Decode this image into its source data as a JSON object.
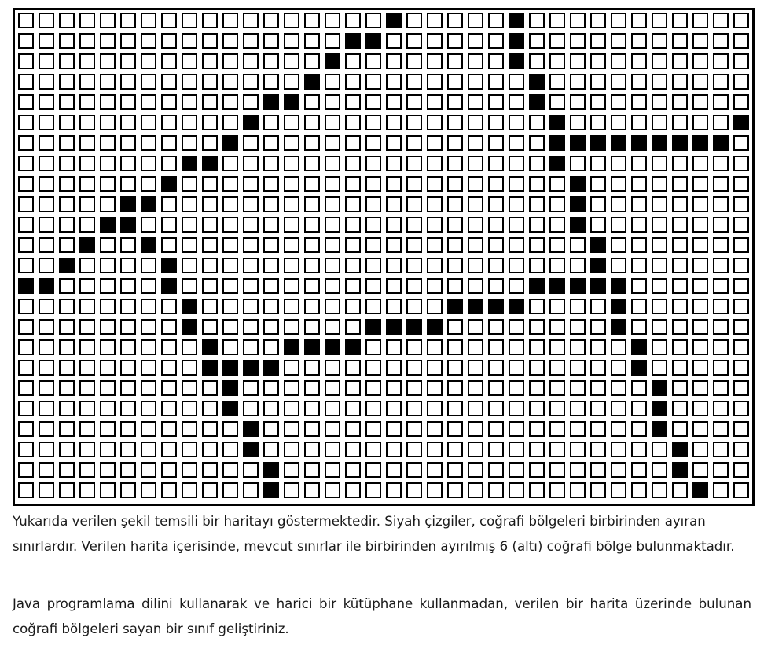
{
  "map": {
    "columns": 36,
    "rows": 24,
    "colors": {
      "border": "#000000",
      "empty_cell": "#ffffff",
      "filled_cell": "#000000"
    },
    "filled_cells": [
      [
        0,
        18
      ],
      [
        0,
        24
      ],
      [
        1,
        16
      ],
      [
        1,
        17
      ],
      [
        1,
        24
      ],
      [
        2,
        15
      ],
      [
        2,
        24
      ],
      [
        3,
        14
      ],
      [
        3,
        25
      ],
      [
        4,
        12
      ],
      [
        4,
        13
      ],
      [
        4,
        25
      ],
      [
        5,
        11
      ],
      [
        5,
        26
      ],
      [
        5,
        35
      ],
      [
        6,
        10
      ],
      [
        6,
        26
      ],
      [
        6,
        27
      ],
      [
        6,
        28
      ],
      [
        6,
        29
      ],
      [
        6,
        30
      ],
      [
        6,
        31
      ],
      [
        6,
        32
      ],
      [
        6,
        33
      ],
      [
        6,
        34
      ],
      [
        7,
        8
      ],
      [
        7,
        9
      ],
      [
        7,
        26
      ],
      [
        8,
        7
      ],
      [
        8,
        27
      ],
      [
        9,
        5
      ],
      [
        9,
        6
      ],
      [
        9,
        27
      ],
      [
        10,
        4
      ],
      [
        10,
        5
      ],
      [
        10,
        27
      ],
      [
        11,
        3
      ],
      [
        11,
        6
      ],
      [
        11,
        28
      ],
      [
        12,
        2
      ],
      [
        12,
        7
      ],
      [
        12,
        28
      ],
      [
        13,
        0
      ],
      [
        13,
        1
      ],
      [
        13,
        7
      ],
      [
        13,
        25
      ],
      [
        13,
        26
      ],
      [
        13,
        27
      ],
      [
        13,
        28
      ],
      [
        13,
        29
      ],
      [
        14,
        8
      ],
      [
        14,
        21
      ],
      [
        14,
        22
      ],
      [
        14,
        23
      ],
      [
        14,
        24
      ],
      [
        14,
        29
      ],
      [
        15,
        8
      ],
      [
        15,
        17
      ],
      [
        15,
        18
      ],
      [
        15,
        19
      ],
      [
        15,
        20
      ],
      [
        15,
        29
      ],
      [
        16,
        9
      ],
      [
        16,
        13
      ],
      [
        16,
        14
      ],
      [
        16,
        15
      ],
      [
        16,
        16
      ],
      [
        16,
        30
      ],
      [
        17,
        9
      ],
      [
        17,
        10
      ],
      [
        17,
        11
      ],
      [
        17,
        12
      ],
      [
        17,
        30
      ],
      [
        18,
        10
      ],
      [
        18,
        31
      ],
      [
        19,
        10
      ],
      [
        19,
        31
      ],
      [
        20,
        11
      ],
      [
        20,
        31
      ],
      [
        21,
        11
      ],
      [
        21,
        32
      ],
      [
        22,
        12
      ],
      [
        22,
        32
      ],
      [
        23,
        12
      ],
      [
        23,
        33
      ]
    ]
  },
  "text": {
    "paragraph_1": "Yukarıda verilen şekil temsili bir haritayı göstermektedir. Siyah çizgiler, coğrafi bölgeleri birbirinden ayıran sınırlardır. Verilen harita içerisinde, mevcut sınırlar ile birbirinden ayırılmış 6 (altı) coğrafi bölge bulunmaktadır.",
    "paragraph_2": "Java programlama dilini kullanarak ve harici bir kütüphane kullanmadan, verilen bir harita üzerinde bulunan coğrafi bölgeleri sayan bir sınıf geliştiriniz."
  }
}
